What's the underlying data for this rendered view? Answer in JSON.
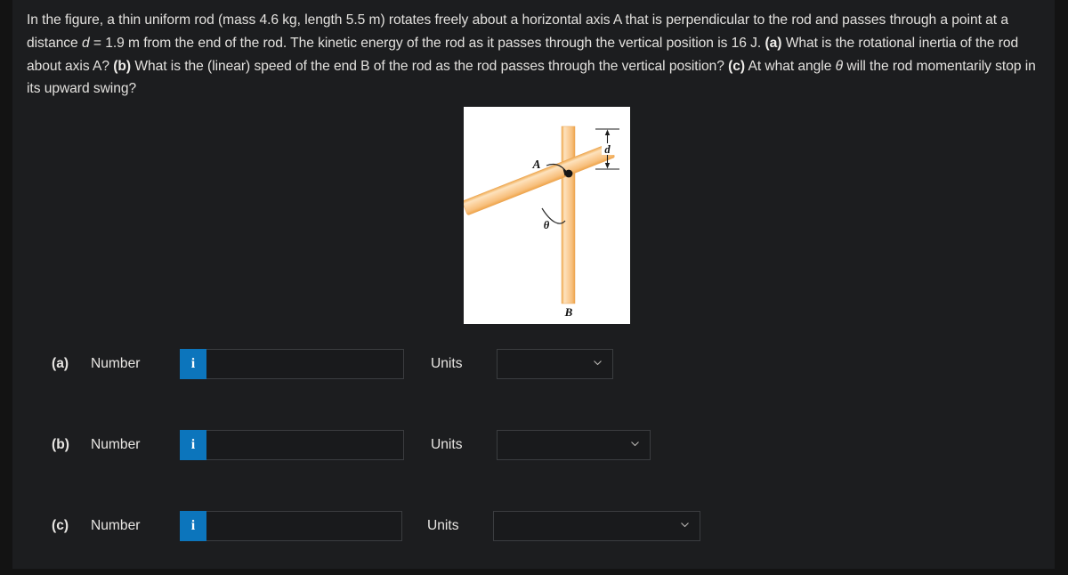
{
  "problem": {
    "line1_a": "In the figure, a thin uniform rod (mass 4.6 kg, length 5.5 m) rotates freely about a horizontal axis A that is perpendicular to the rod and",
    "line2_a": "passes through a point at a distance ",
    "line2_var": "d",
    "line2_b": " = 1.9 m from the end of the rod. The kinetic energy of the rod as it passes through the vertical",
    "line3_a": "position is 16 J. ",
    "line3_bold_a": "(a)",
    "line3_b": " What is the rotational inertia of the rod about axis A? ",
    "line3_bold_b": "(b)",
    "line3_c": " What is the (linear) speed of the end B of the rod as the rod",
    "line4_a": "passes through the vertical position? ",
    "line4_bold_c": "(c)",
    "line4_b": " At what angle ",
    "line4_var": "θ",
    "line4_c": " will the rod momentarily stop in its upward swing?",
    "mass": "4.6 kg",
    "length": "5.5 m",
    "distance_d": "1.9 m",
    "kinetic_energy": "16 J"
  },
  "figure": {
    "label_axis": "A",
    "label_angle": "θ",
    "label_end": "B",
    "label_distance": "d",
    "rod_color": "#f6c381",
    "rod_highlight": "#fde4c2",
    "background": "#ffffff"
  },
  "answers": [
    {
      "id": "a",
      "part_label": "(a)",
      "number_label": "Number",
      "info_icon": "info-icon",
      "info_glyph": "i",
      "number_value": "",
      "number_placeholder": "",
      "units_label": "Units",
      "units_value": "",
      "units_width": 131,
      "input_width": 215,
      "chevron_icon": "chevron-down-icon"
    },
    {
      "id": "b",
      "part_label": "(b)",
      "number_label": "Number",
      "info_icon": "info-icon",
      "info_glyph": "i",
      "number_value": "",
      "number_placeholder": "",
      "units_label": "Units",
      "units_value": "",
      "units_width": 173,
      "input_width": 215,
      "chevron_icon": "chevron-down-icon"
    },
    {
      "id": "c",
      "part_label": "(c)",
      "number_label": "Number",
      "info_icon": "info-icon",
      "info_glyph": "i",
      "number_value": "",
      "number_placeholder": "",
      "units_label": "Units",
      "units_value": "",
      "units_width": 233,
      "input_width": 215,
      "chevron_icon": "chevron-down-icon"
    }
  ],
  "colors": {
    "background": "#131313",
    "panel": "#1c1d1f",
    "accent_blue": "#0c75bc",
    "text": "#e8e6e3",
    "border": "#3b3d40"
  }
}
